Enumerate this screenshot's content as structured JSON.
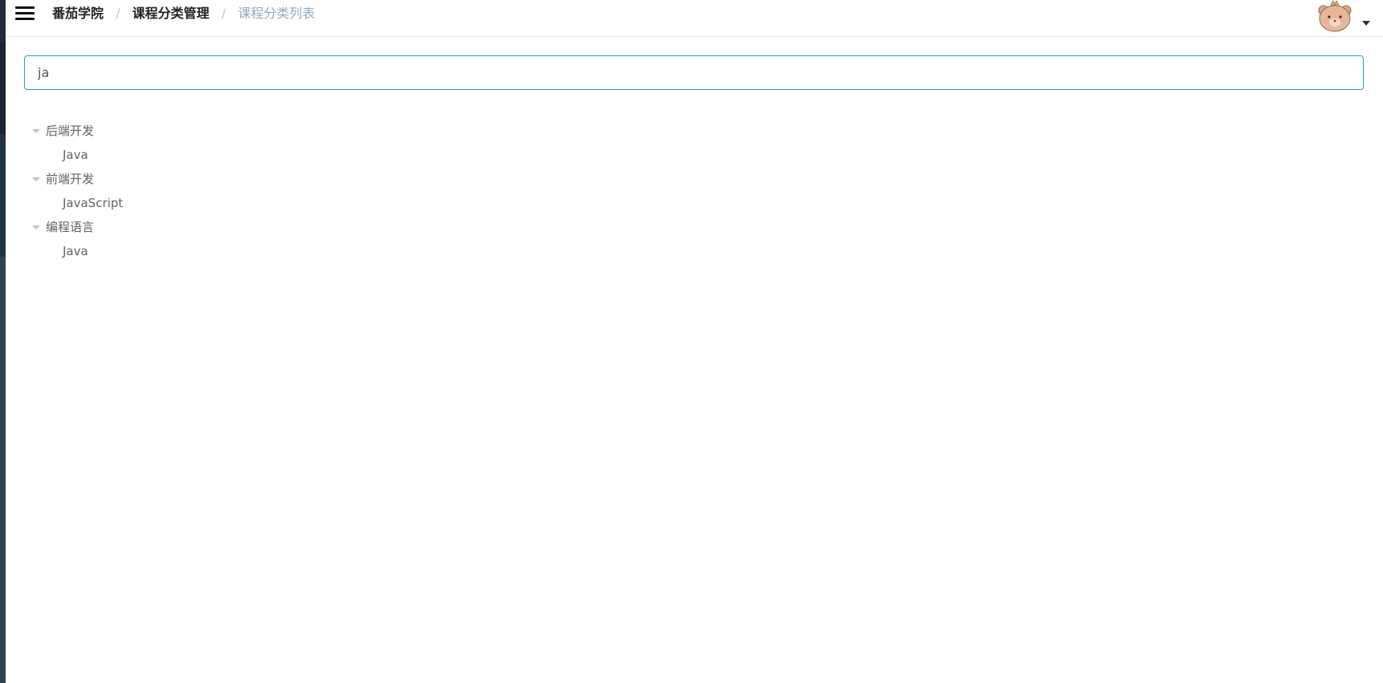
{
  "navbar": {
    "breadcrumb": [
      {
        "label": "番茄学院"
      },
      {
        "label": "课程分类管理"
      },
      {
        "label": "课程分类列表"
      }
    ],
    "separator": "/"
  },
  "search": {
    "value": "ja"
  },
  "tree": [
    {
      "label": "后端开发",
      "children": [
        {
          "label": "Java"
        }
      ]
    },
    {
      "label": "前端开发",
      "children": [
        {
          "label": "JavaScript"
        }
      ]
    },
    {
      "label": "编程语言",
      "children": [
        {
          "label": "Java"
        }
      ]
    }
  ],
  "colors": {
    "accent": "#1f9fc4",
    "sidebar": "#304156",
    "breadcrumb_current": "#97a8be"
  }
}
